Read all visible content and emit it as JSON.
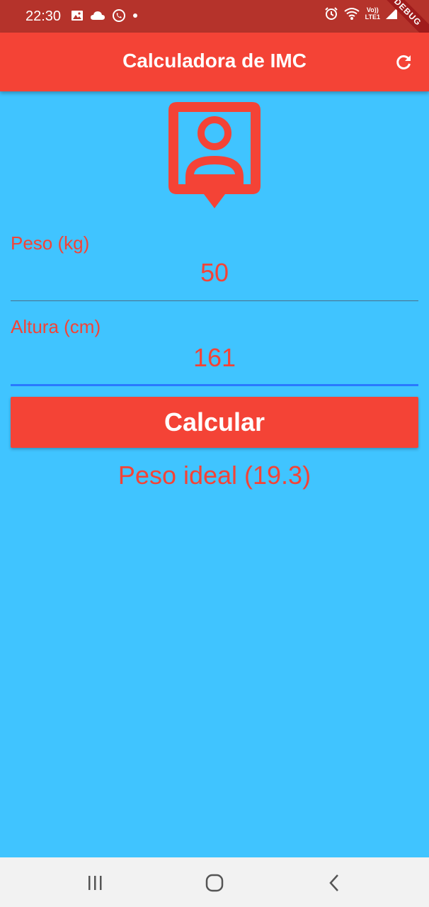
{
  "status_bar": {
    "time": "22:30",
    "network_label_top": "Vo))",
    "network_label_bottom": "LTE1",
    "left_icons": [
      "image-icon",
      "cloud-icon",
      "whatsapp-icon",
      "dot-icon"
    ],
    "right_icons": [
      "alarm-icon",
      "wifi-icon",
      "volte-indicator",
      "signal-icon"
    ]
  },
  "debug_banner": "DEBUG",
  "app_bar": {
    "title": "Calculadora de IMC",
    "refresh_icon": "refresh-icon"
  },
  "form": {
    "weight": {
      "label": "Peso (kg)",
      "value": "50"
    },
    "height": {
      "label": "Altura (cm)",
      "value": "161"
    },
    "calculate_label": "Calcular"
  },
  "result": {
    "text": "Peso ideal (19.3)"
  },
  "nav_bar": {
    "buttons": [
      "recent-apps-icon",
      "home-icon",
      "back-icon"
    ]
  },
  "colors": {
    "primary": "#f44336",
    "status_bar": "#b5332b",
    "background": "#40c4ff",
    "nav_bar": "#f2f2f2",
    "focus_underline": "#2979ff"
  }
}
